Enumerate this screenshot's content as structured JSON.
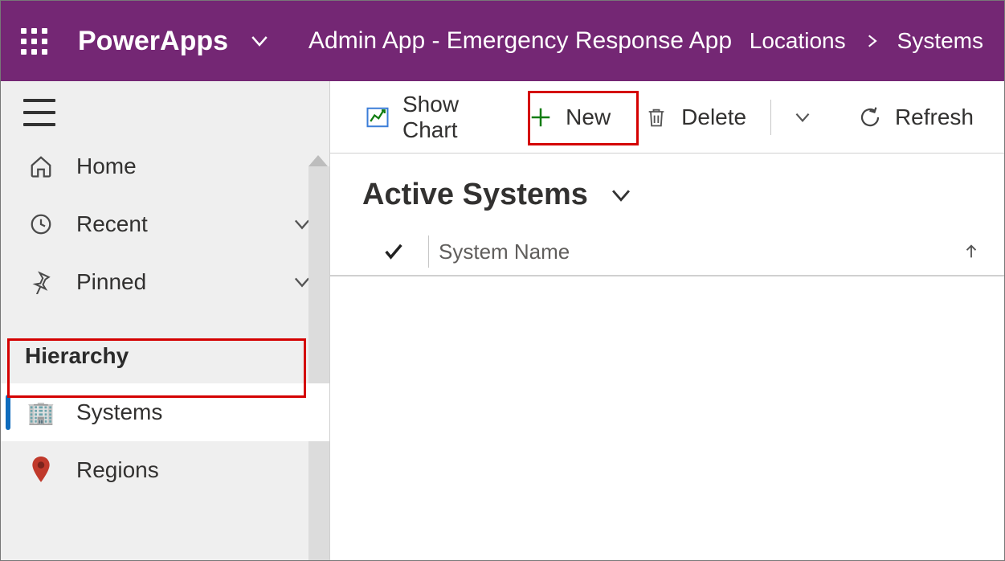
{
  "header": {
    "brand": "PowerApps",
    "app_title": "Admin App - Emergency Response App",
    "breadcrumbs": [
      "Locations",
      "Systems"
    ]
  },
  "sidebar": {
    "nav": [
      {
        "icon": "home-icon",
        "label": "Home",
        "expandable": false
      },
      {
        "icon": "clock-icon",
        "label": "Recent",
        "expandable": true
      },
      {
        "icon": "pin-icon",
        "label": "Pinned",
        "expandable": true
      }
    ],
    "section_title": "Hierarchy",
    "hierarchy": [
      {
        "icon": "building-icon",
        "label": "Systems",
        "active": true
      },
      {
        "icon": "mappin-icon",
        "label": "Regions",
        "active": false
      }
    ]
  },
  "commandbar": {
    "show_chart": "Show Chart",
    "new": "New",
    "delete": "Delete",
    "refresh": "Refresh"
  },
  "view": {
    "title": "Active Systems",
    "columns": [
      {
        "name": "System Name",
        "sort": "asc"
      }
    ],
    "rows": []
  }
}
